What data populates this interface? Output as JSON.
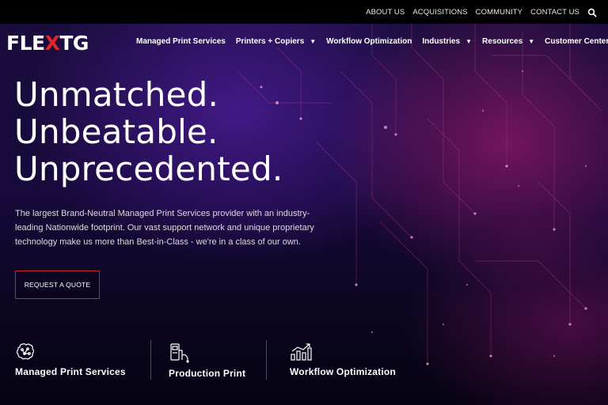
{
  "topbar": {
    "links": [
      "ABOUT US",
      "ACQUISITIONS",
      "COMMUNITY",
      "CONTACT US"
    ],
    "search_icon": "search-icon"
  },
  "brand": {
    "logo_part1": "FLE",
    "logo_x": "X",
    "logo_part2": "TG",
    "accent": "#e3242b"
  },
  "nav": {
    "items": [
      {
        "label": "Managed Print Services",
        "dropdown": false
      },
      {
        "label": "Printers + Copiers",
        "dropdown": true
      },
      {
        "label": "Workflow Optimization",
        "dropdown": false
      },
      {
        "label": "Industries",
        "dropdown": true
      },
      {
        "label": "Resources",
        "dropdown": true
      },
      {
        "label": "Customer Center",
        "dropdown": false
      }
    ]
  },
  "hero": {
    "headline": [
      "Unmatched.",
      "Unbeatable.",
      "Unprecedented."
    ],
    "blurb": "The largest Brand-Neutral Managed Print Services provider with an industry-leading Nationwide footprint. Our vast support network and unique proprietary technology make us more than Best-in-Class - we're in a class of our own.",
    "cta": "REQUEST A QUOTE"
  },
  "services": [
    {
      "label": "Managed Print Services",
      "icon": "brain-icon"
    },
    {
      "label": "Production Print",
      "icon": "printer-icon"
    },
    {
      "label": "Workflow Optimization",
      "icon": "chart-icon"
    }
  ]
}
